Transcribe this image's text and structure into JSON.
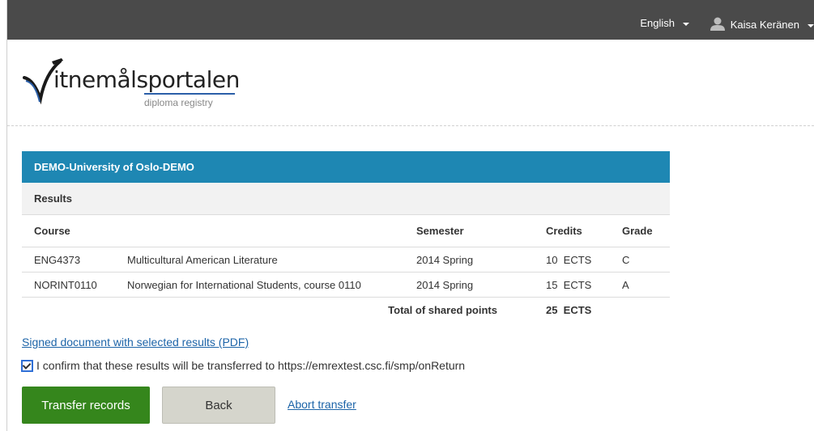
{
  "header": {
    "language": "English",
    "user": "Kaisa Keränen"
  },
  "logo": {
    "main": "itnemålsportalen",
    "sub": "diploma registry"
  },
  "panel": {
    "institution": "DEMO-University of Oslo-DEMO",
    "section": "Results",
    "columns": [
      "Course",
      "Semester",
      "Credits",
      "Grade"
    ],
    "rows": [
      {
        "code": "ENG4373",
        "name": "Multicultural American Literature",
        "semester": "2014 Spring",
        "credits": "10  ECTS",
        "grade": "C"
      },
      {
        "code": "NORINT0110",
        "name": "Norwegian for International Students, course 0110",
        "semester": "2014 Spring",
        "credits": "15  ECTS",
        "grade": "A"
      }
    ],
    "total_label": "Total of shared points",
    "total_value": "25  ECTS"
  },
  "pdf_link": "Signed document with selected results (PDF)",
  "confirm_text": "I confirm that these results will be transferred to https://emrextest.csc.fi/smp/onReturn",
  "buttons": {
    "transfer": "Transfer records",
    "back": "Back",
    "abort": "Abort transfer"
  }
}
